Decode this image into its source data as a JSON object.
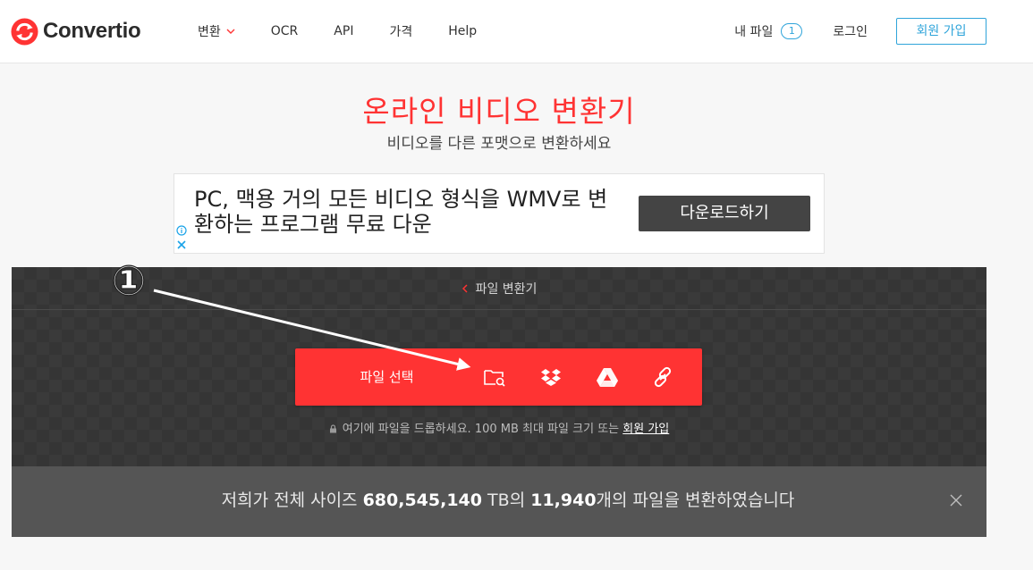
{
  "header": {
    "logo_text": "Convertio",
    "nav": [
      {
        "label": "변환",
        "has_dropdown": true
      },
      {
        "label": "OCR"
      },
      {
        "label": "API"
      },
      {
        "label": "가격"
      },
      {
        "label": "Help"
      }
    ],
    "my_files_label": "내 파일",
    "my_files_count": "1",
    "login_label": "로그인",
    "signup_label": "회원 가입"
  },
  "hero": {
    "title": "온라인 비디오 변환기",
    "subtitle": "비디오를 다른 포맷으로 변환하세요"
  },
  "ad": {
    "text": "PC, 맥용 거의 모든 비디오 형식을 WMV로 변환하는 프로그램 무료 다운",
    "button_label": "다운로드하기"
  },
  "uploader": {
    "breadcrumb_label": "파일 변환기",
    "select_label": "파일 선택",
    "sources": [
      "folder-search-icon",
      "dropbox-icon",
      "google-drive-icon",
      "link-icon"
    ],
    "hint_text": "여기에 파일을 드롭하세요. 100 MB 최대 파일 크기 또는",
    "hint_link": "회원 가입"
  },
  "stats": {
    "prefix": "저희가 전체 사이즈",
    "size_value": "680,545,140",
    "size_unit": "TB의",
    "file_count": "11,940",
    "suffix": "개의 파일을 변환하였습니다"
  },
  "annotation": {
    "marker": "①"
  },
  "colors": {
    "accent_red": "#ff3333",
    "accent_blue": "#2fa4da",
    "dark_panel": "#3a3a3a",
    "stats_bar": "#555555"
  }
}
